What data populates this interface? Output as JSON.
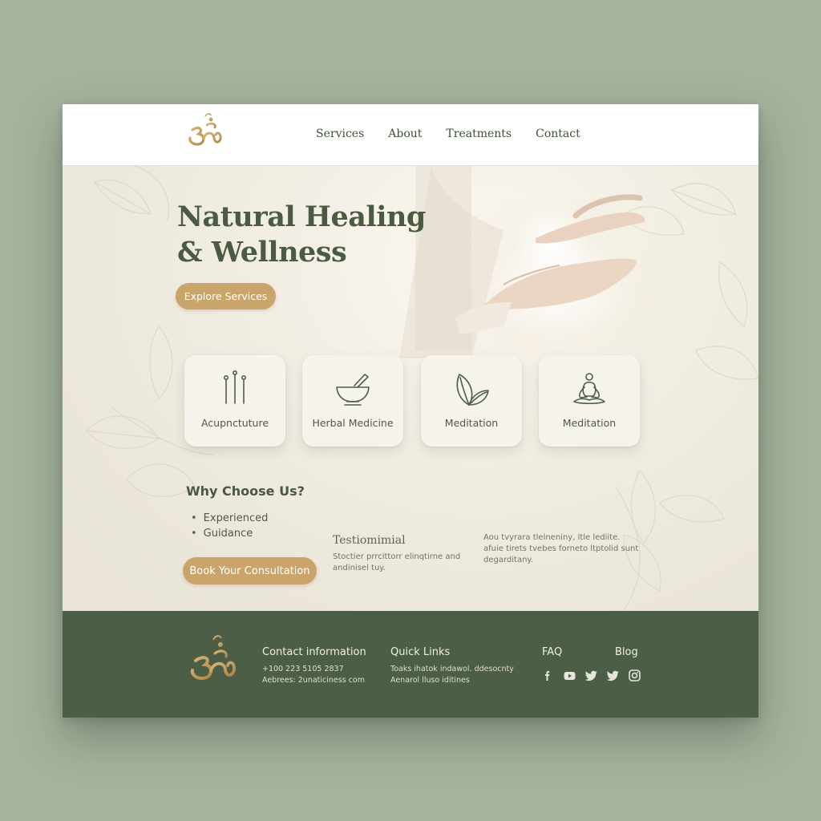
{
  "brand": {
    "logo_icon": "om-symbol-icon",
    "accent_gold": "#c9a46b",
    "primary_green": "#4c5e45"
  },
  "nav": {
    "items": [
      {
        "label": "Services"
      },
      {
        "label": "About"
      },
      {
        "label": "Treatments"
      },
      {
        "label": "Contact"
      }
    ]
  },
  "hero": {
    "title_line1": "Natural Healing",
    "title_line2": "& Wellness",
    "cta_label": "Explore Services",
    "image": "cupped-hands-light-icon"
  },
  "services": [
    {
      "label": "Acupnctuture",
      "icon": "acupuncture-needles-icon"
    },
    {
      "label": "Herbal Medicine",
      "icon": "mortar-pestle-icon"
    },
    {
      "label": "Meditation",
      "icon": "leaf-icon"
    },
    {
      "label": "Meditation",
      "icon": "meditation-figure-icon"
    }
  ],
  "why": {
    "title": "Why Choose Us?",
    "points": [
      "Experienced",
      "Guidance"
    ],
    "cta_label": "Book Your Consultation"
  },
  "testimonial": {
    "title": "Testiomimial",
    "line1": "Stoctier prrcittorr elinqtirne and",
    "line2": "andinisel tuy.",
    "quote_line1": "Aou tvyrara tlelneniny, ltle lediite.",
    "quote_line2": "afuie tirets tvebes forneto ltptolid sunt",
    "quote_line3": "degarditany."
  },
  "footer": {
    "contact_title": "Contact information",
    "phone": "+100 223 5105 2837",
    "address": "Aebrees: 2unaticiness com",
    "quick_links_title": "Quick Links",
    "quick_line1": "Toaks ihatok  indawol. ddesocnty",
    "quick_line2": "Aenarol lluso iditines",
    "faq_label": "FAQ",
    "blog_label": "Blog",
    "social_icons": [
      "facebook-icon",
      "youtube-icon",
      "twitter-icon",
      "twitter-icon",
      "instagram-icon"
    ]
  }
}
